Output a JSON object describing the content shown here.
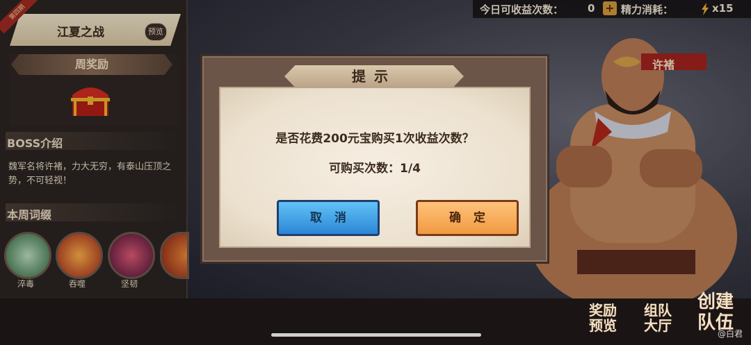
{
  "top_stats": {
    "earnings_label": "今日可收益次数：",
    "earnings_value": "0",
    "energy_label": "精力消耗：",
    "energy_value": "x15"
  },
  "left_panel": {
    "corner_ribbon": "第四期",
    "stage_name": "江夏之战",
    "preview_badge": "预览",
    "weekly_reward_title": "周奖励",
    "boss_intro_title": "BOSS介绍",
    "boss_description": "魏军名将许褚，力大无穷，有泰山压顶之势，不可轻视！",
    "affix_title": "本周词缀",
    "affixes": [
      {
        "label": "淬毒",
        "icon": "poison-icon"
      },
      {
        "label": "吞噬",
        "icon": "devour-icon"
      },
      {
        "label": "坚韧",
        "icon": "tenacity-icon"
      },
      {
        "label": "",
        "icon": "partial-affix-icon"
      }
    ]
  },
  "boss": {
    "name": "许褚"
  },
  "dialog": {
    "title": "提示",
    "message": "是否花费200元宝购买1次收益次数？",
    "sub_message": "可购买次数：1/4",
    "cancel_label": "取消",
    "confirm_label": "确定"
  },
  "bottom_menu": {
    "reward_preview": [
      "奖励",
      "预览"
    ],
    "team_hall": [
      "组队",
      "大厅"
    ],
    "create_team": [
      "创建",
      "队伍"
    ]
  },
  "watermark": "@白君",
  "colors": {
    "cancel_button": "#3a9be6",
    "confirm_button": "#f3a650",
    "dialog_frame": "#6a5548",
    "dialog_paper": "#f2e9da"
  }
}
